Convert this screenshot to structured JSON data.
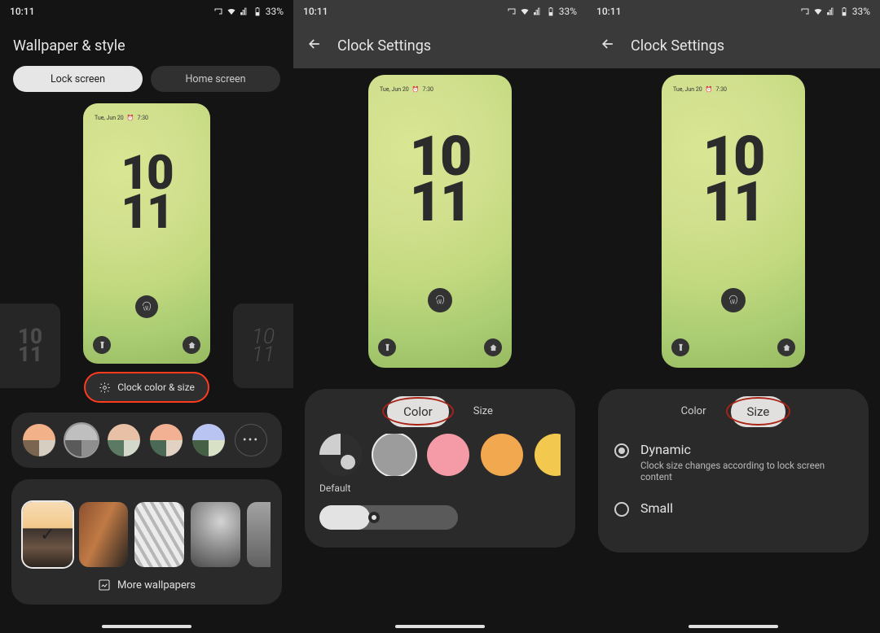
{
  "status": {
    "time": "10:11",
    "battery": "33%"
  },
  "pane1": {
    "title": "Wallpaper & style",
    "tab_lock": "Lock screen",
    "tab_home": "Home screen",
    "preview": {
      "date": "Tue, Jun 20",
      "alarm_time": "7:30",
      "clock_top": "10",
      "clock_bot": "11"
    },
    "side_clock": "10\n11",
    "ccs_label": "Clock color & size",
    "more_wallpapers": "More wallpapers",
    "swatches": [
      {
        "tl": "#f3b189",
        "tr": "#f3b189",
        "bl": "#7a6650",
        "br": "#d7cec2"
      },
      {
        "tl": "#bfbfbf",
        "tr": "#bfbfbf",
        "bl": "#5a5a5a",
        "br": "#8f8f8f"
      },
      {
        "tl": "#e8c0a6",
        "tr": "#e8c0a6",
        "bl": "#5c7a63",
        "br": "#d3dacb"
      },
      {
        "tl": "#f2b192",
        "tr": "#f2b192",
        "bl": "#4a6a55",
        "br": "#e2d2c3"
      },
      {
        "tl": "#b9c4f3",
        "tr": "#b9c4f3",
        "bl": "#466046",
        "br": "#d8e0c6"
      }
    ]
  },
  "pane2": {
    "title": "Clock Settings",
    "tab_color": "Color",
    "tab_size": "Size",
    "preview": {
      "date": "Tue, Jun 20",
      "alarm_time": "7:30",
      "clock_top": "10",
      "clock_bot": "11"
    },
    "default_label": "Default"
  },
  "pane3": {
    "title": "Clock Settings",
    "tab_color": "Color",
    "tab_size": "Size",
    "preview": {
      "date": "Tue, Jun 20",
      "alarm_time": "7:30",
      "clock_top": "10",
      "clock_bot": "11"
    },
    "opt_dynamic": "Dynamic",
    "opt_dynamic_sub": "Clock size changes according to lock screen content",
    "opt_small": "Small"
  }
}
